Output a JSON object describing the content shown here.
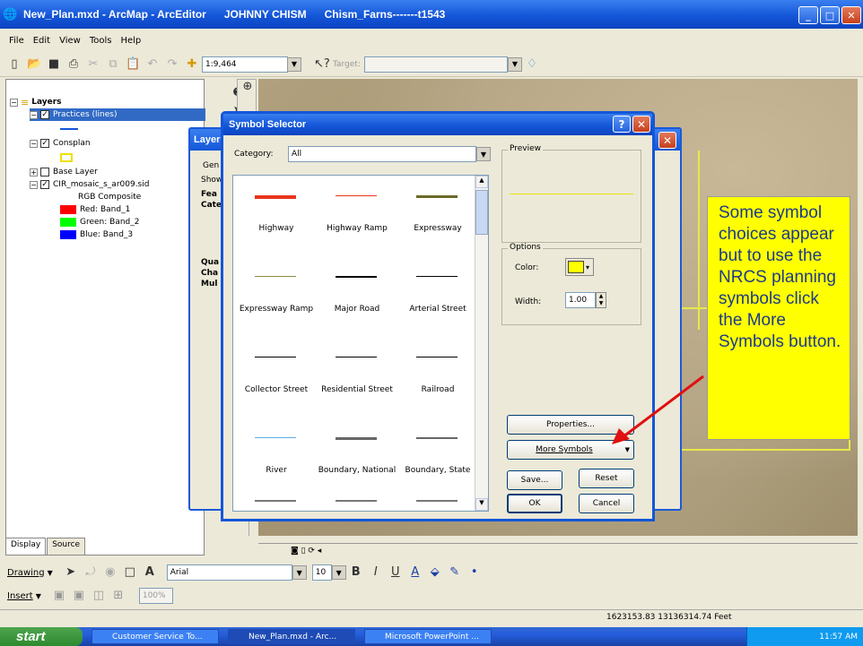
{
  "window": {
    "title": "New_Plan.mxd - ArcMap - ArcEditor      JOHNNY CHISM      Chism_Farns-------t1543",
    "min": "_",
    "max": "□",
    "close": "✕"
  },
  "menu": [
    "File",
    "Edit",
    "View",
    "Tools",
    "Help"
  ],
  "toolbar": {
    "scale": "1:9,464",
    "target_label": "Target:",
    "target_value": ""
  },
  "toc": {
    "layers_label": "Layers",
    "practices": "Practices (lines)",
    "consplan": "Consplan",
    "base_layer": "Base Layer",
    "cir": "CIR_mosaic_s_ar009.sid",
    "rgb": "RGB Composite",
    "red": "Red:   Band_1",
    "green": "Green: Band_2",
    "blue": "Blue:  Band_3",
    "tabs": [
      "Display",
      "Source"
    ]
  },
  "layer_props": {
    "title": "Layer",
    "tab": "Gen",
    "show": "Show",
    "items": [
      "Fea",
      "Cate",
      "Qua",
      "Cha",
      "Mul"
    ]
  },
  "symbol_selector": {
    "title": "Symbol Selector",
    "category_label": "Category:",
    "category_value": "All",
    "preview_label": "Preview",
    "options_label": "Options",
    "color_label": "Color:",
    "width_label": "Width:",
    "width_value": "1.00",
    "symbols": [
      {
        "name": "Highway",
        "color": "#e8341c",
        "weight": 4
      },
      {
        "name": "Highway Ramp",
        "color": "#e8341c",
        "weight": 1
      },
      {
        "name": "Expressway",
        "color": "#6a6a28",
        "weight": 3
      },
      {
        "name": "Expressway Ramp",
        "color": "#8b8b40",
        "weight": 1
      },
      {
        "name": "Major Road",
        "color": "#000000",
        "weight": 2
      },
      {
        "name": "Arterial Street",
        "color": "#000000",
        "weight": 1
      },
      {
        "name": "Collector Street",
        "color": "#000000",
        "weight": 1
      },
      {
        "name": "Residential Street",
        "color": "#000000",
        "weight": 1
      },
      {
        "name": "Railroad",
        "color": "#000000",
        "weight": 1
      },
      {
        "name": "River",
        "color": "#5ab0e8",
        "weight": 1
      },
      {
        "name": "Boundary, National",
        "color": "#666666",
        "weight": 3
      },
      {
        "name": "Boundary, State",
        "color": "#666666",
        "weight": 2
      }
    ],
    "buttons": {
      "properties": "Properties...",
      "more_symbols": "More Symbols",
      "save": "Save...",
      "reset": "Reset",
      "ok": "OK",
      "cancel": "Cancel"
    },
    "help": "?",
    "close": "✕"
  },
  "callout": {
    "text": "Some symbol choices appear but to use the NRCS planning symbols click the More Symbols button."
  },
  "drawing_bar": {
    "drawing": "Drawing",
    "font": "Arial",
    "size": "10",
    "insert": "Insert",
    "zoom": "100%"
  },
  "status": {
    "coords": "1623153.83  13136314.74 Feet"
  },
  "taskbar": {
    "start": "start",
    "tasks": [
      "Customer Service To...",
      "New_Plan.mxd - Arc...",
      "Microsoft PowerPoint ..."
    ],
    "clock": "11:57 AM"
  },
  "colors": {
    "accent": "#1456d8",
    "callout_bg": "#ffff00",
    "callout_text": "#1d3b8a",
    "swatch_red": "#ff0000",
    "swatch_green": "#00ff00",
    "swatch_blue": "#0000ff",
    "symbol_color": "#ffff00"
  }
}
